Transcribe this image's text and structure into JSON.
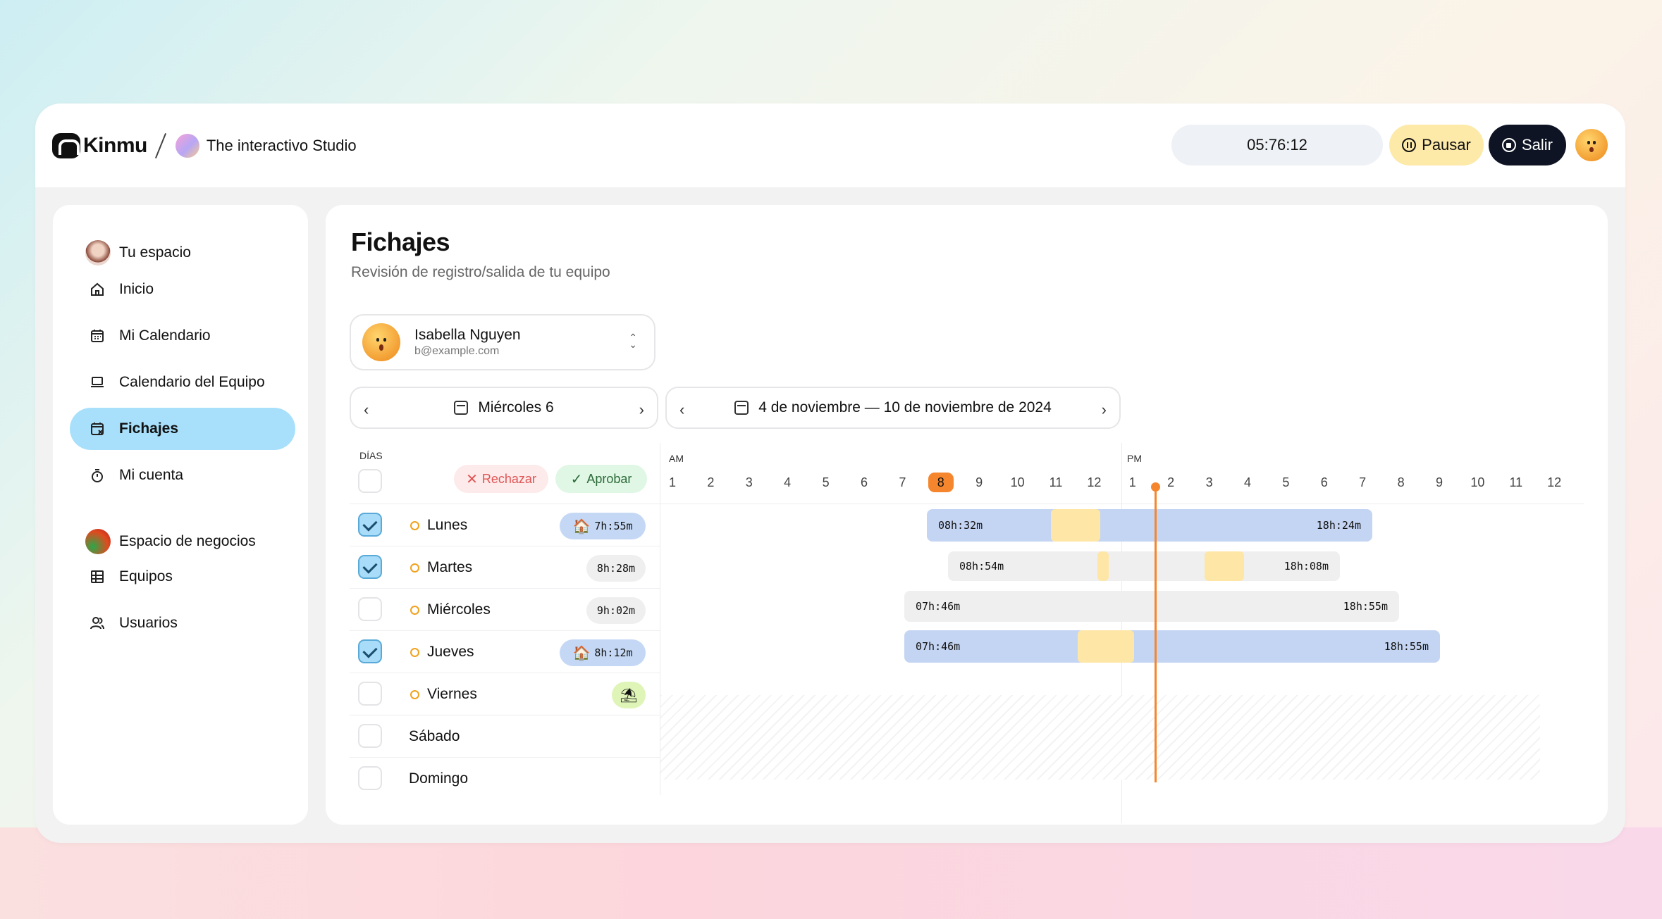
{
  "brand": {
    "name": "Kinmu",
    "workspace": "The interactivo Studio"
  },
  "header": {
    "timer": "05:76:12",
    "pause_label": "Pausar",
    "exit_label": "Salir"
  },
  "sidebar": {
    "personal_title": "Tu espacio",
    "items": [
      {
        "label": "Inicio",
        "icon": "home-icon"
      },
      {
        "label": "Mi Calendario",
        "icon": "calendar-icon"
      },
      {
        "label": "Calendario del Equipo",
        "icon": "laptop-icon"
      },
      {
        "label": "Fichajes",
        "icon": "calendar-check-icon",
        "active": true
      },
      {
        "label": "Mi cuenta",
        "icon": "stopwatch-icon"
      }
    ],
    "business_title": "Espacio de negocios",
    "business_items": [
      {
        "label": "Equipos",
        "icon": "grid-icon"
      },
      {
        "label": "Usuarios",
        "icon": "users-icon"
      }
    ]
  },
  "page": {
    "title": "Fichajes",
    "subtitle": "Revisión de registro/salida de tu equipo"
  },
  "user_select": {
    "name": "Isabella Nguyen",
    "email": "b@example.com"
  },
  "day_pager": {
    "label": "Miércoles 6"
  },
  "week_pager": {
    "label": "4 de noviembre — 10 de noviembre de 2024"
  },
  "days_table": {
    "header": "DÍAS",
    "reject_label": "Rechazar",
    "approve_label": "Aprobar",
    "rows": [
      {
        "day": "Lunes",
        "checked": true,
        "status_dot": true,
        "badge": "7h:55m",
        "badge_style": "blue",
        "remote": true
      },
      {
        "day": "Martes",
        "checked": true,
        "status_dot": true,
        "badge": "8h:28m",
        "badge_style": "gray",
        "remote": false
      },
      {
        "day": "Miércoles",
        "checked": false,
        "status_dot": true,
        "badge": "9h:02m",
        "badge_style": "gray",
        "remote": false
      },
      {
        "day": "Jueves",
        "checked": true,
        "status_dot": true,
        "badge": "8h:12m",
        "badge_style": "blue",
        "remote": true
      },
      {
        "day": "Viernes",
        "checked": false,
        "status_dot": true,
        "badge": "",
        "badge_style": "green",
        "vacation": true
      },
      {
        "day": "Sábado",
        "checked": false,
        "status_dot": false
      },
      {
        "day": "Domingo",
        "checked": false,
        "status_dot": false
      }
    ]
  },
  "timeline": {
    "am_label": "AM",
    "pm_label": "PM",
    "am_hours": [
      "1",
      "2",
      "3",
      "4",
      "5",
      "6",
      "7",
      "8",
      "9",
      "10",
      "11",
      "12"
    ],
    "pm_hours": [
      "1",
      "2",
      "3",
      "4",
      "5",
      "6",
      "7",
      "8",
      "9",
      "10",
      "11",
      "12"
    ],
    "current_hour": "8",
    "bars": [
      {
        "start": "08h:32m",
        "end": "18h:24m",
        "style": "blue"
      },
      {
        "start": "08h:54m",
        "end": "18h:08m",
        "style": "gray"
      },
      {
        "start": "07h:46m",
        "end": "18h:55m",
        "style": "gray"
      },
      {
        "start": "07h:46m",
        "end": "18h:55m",
        "style": "blue"
      }
    ]
  },
  "colors": {
    "accent": "#a8e0fb",
    "now": "#f5862e",
    "bar_blue": "#c4d5f3",
    "pause": "#fde6a6"
  }
}
